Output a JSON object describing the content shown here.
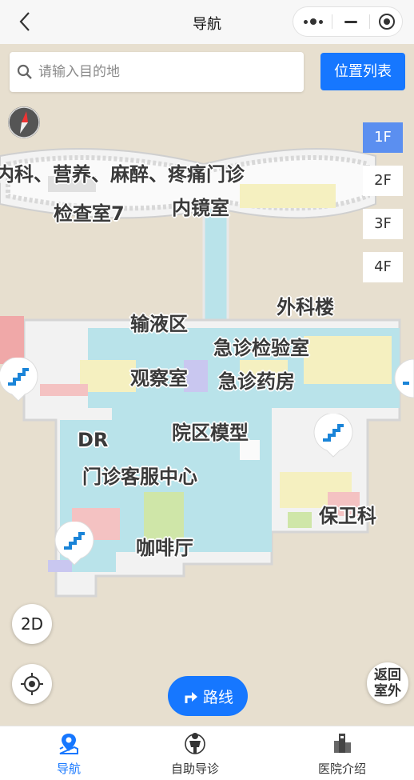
{
  "header": {
    "title": "导航"
  },
  "search": {
    "placeholder": "请输入目的地",
    "button": "位置列表"
  },
  "floors": [
    "1F",
    "2F",
    "3F",
    "4F"
  ],
  "active_floor": "1F",
  "map_labels": {
    "depts_top": "内科、营养、麻醉、疼痛门诊",
    "exam7": "检查室7",
    "endoscopy": "内镜室",
    "surgery_bldg": "外科楼",
    "infusion": "输液区",
    "er_lab": "急诊检验室",
    "observation": "观察室",
    "er_pharmacy": "急诊药房",
    "campus_model": "院区模型",
    "dr": "DR",
    "service_center": "门诊客服中心",
    "security": "保卫科",
    "cafe": "咖啡厅"
  },
  "controls": {
    "view_mode": "2D",
    "route": "路线",
    "outdoor": [
      "返回",
      "室外"
    ]
  },
  "tabs": [
    {
      "label": "导航",
      "icon": "map-pin-icon",
      "active": true
    },
    {
      "label": "自助导诊",
      "icon": "person-icon",
      "active": false
    },
    {
      "label": "医院介绍",
      "icon": "building-icon",
      "active": false
    }
  ],
  "colors": {
    "accent": "#1677ff",
    "active_floor": "#5b8ff0",
    "corridor": "#b9e3ea",
    "ground": "#e7dfcf"
  }
}
